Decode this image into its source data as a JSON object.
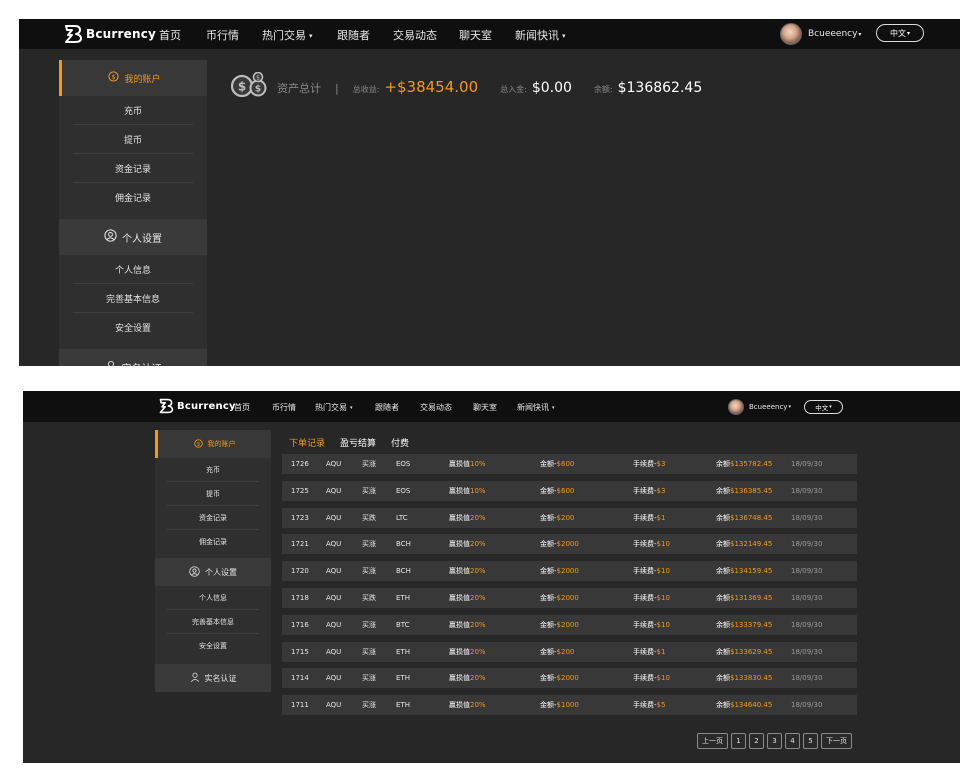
{
  "brand": {
    "name": "Bcurrency"
  },
  "nav": {
    "items": [
      {
        "label": "首页",
        "dropdown": false
      },
      {
        "label": "币行情",
        "dropdown": false
      },
      {
        "label": "热门交易",
        "dropdown": true
      },
      {
        "label": "跟随者",
        "dropdown": false
      },
      {
        "label": "交易动态",
        "dropdown": false
      },
      {
        "label": "聊天室",
        "dropdown": false
      },
      {
        "label": "新闻快讯",
        "dropdown": true
      }
    ],
    "user_name": "Bcueeency",
    "user_caret": "▾",
    "language": "中文",
    "language_caret": "▾",
    "caret": "▾"
  },
  "sidebar": {
    "account": {
      "label": "我的账户",
      "icon": "dollar-circle-icon"
    },
    "account_items": [
      "充币",
      "提币",
      "资金记录",
      "佣金记录"
    ],
    "settings": {
      "label": "个人设置",
      "icon": "user-circle-icon"
    },
    "settings_items": [
      "个人信息",
      "完善基本信息",
      "安全设置"
    ],
    "verify": {
      "label": "实名认证",
      "icon": "user-icon"
    }
  },
  "summary": {
    "title": "资产总计",
    "separator": "|",
    "profit_label": "总收益:",
    "profit_value": "+$38454.00",
    "deposit_label": "总入金:",
    "deposit_value": "$0.00",
    "balance_label": "余额:",
    "balance_value": "$136862.45",
    "icon": "coins-icon"
  },
  "tabs": [
    {
      "label": "下单记录",
      "active": true
    },
    {
      "label": "盈亏结算",
      "active": false
    },
    {
      "label": "付费",
      "active": false
    }
  ],
  "records": {
    "labels": {
      "pl": "赢损值",
      "amount": "金额-",
      "fee": "手续费-",
      "balance": "余额"
    },
    "rows": [
      {
        "id": "1726",
        "coin": "AQU",
        "dir": "买涨",
        "pair": "EOS",
        "pl": "10%",
        "amount": "$600",
        "fee": "$3",
        "balance": "$135782.45",
        "date": "18/09/30"
      },
      {
        "id": "1725",
        "coin": "AQU",
        "dir": "买涨",
        "pair": "EOS",
        "pl": "10%",
        "amount": "$600",
        "fee": "$3",
        "balance": "$136385.45",
        "date": "18/09/30"
      },
      {
        "id": "1723",
        "coin": "AQU",
        "dir": "买跌",
        "pair": "LTC",
        "pl": "20%",
        "amount": "$200",
        "fee": "$1",
        "balance": "$136748.45",
        "date": "18/09/30"
      },
      {
        "id": "1721",
        "coin": "AQU",
        "dir": "买涨",
        "pair": "BCH",
        "pl": "20%",
        "amount": "$2000",
        "fee": "$10",
        "balance": "$132149.45",
        "date": "18/09/30"
      },
      {
        "id": "1720",
        "coin": "AQU",
        "dir": "买涨",
        "pair": "BCH",
        "pl": "20%",
        "amount": "$2000",
        "fee": "$10",
        "balance": "$134159.45",
        "date": "18/09/30"
      },
      {
        "id": "1718",
        "coin": "AQU",
        "dir": "买跌",
        "pair": "ETH",
        "pl": "20%",
        "amount": "$2000",
        "fee": "$10",
        "balance": "$131369.45",
        "date": "18/09/30"
      },
      {
        "id": "1716",
        "coin": "AQU",
        "dir": "买涨",
        "pair": "BTC",
        "pl": "20%",
        "amount": "$2000",
        "fee": "$10",
        "balance": "$133379.45",
        "date": "18/09/30"
      },
      {
        "id": "1715",
        "coin": "AQU",
        "dir": "买涨",
        "pair": "ETH",
        "pl": "20%",
        "amount": "$200",
        "fee": "$1",
        "balance": "$133629.45",
        "date": "18/09/30"
      },
      {
        "id": "1714",
        "coin": "AQU",
        "dir": "买涨",
        "pair": "ETH",
        "pl": "20%",
        "amount": "$2000",
        "fee": "$10",
        "balance": "$133830.45",
        "date": "18/09/30"
      },
      {
        "id": "1711",
        "coin": "AQU",
        "dir": "买涨",
        "pair": "ETH",
        "pl": "20%",
        "amount": "$1000",
        "fee": "$5",
        "balance": "$134640.45",
        "date": "18/09/30"
      }
    ]
  },
  "pagination": {
    "prev": "上一页",
    "pages": [
      "1",
      "2",
      "3",
      "4",
      "5"
    ],
    "next": "下一页"
  },
  "colors": {
    "accent": "#f39a1c",
    "nav_bg": "#0f0f0f",
    "page_bg": "#272727",
    "panel_bg": "#383838"
  }
}
